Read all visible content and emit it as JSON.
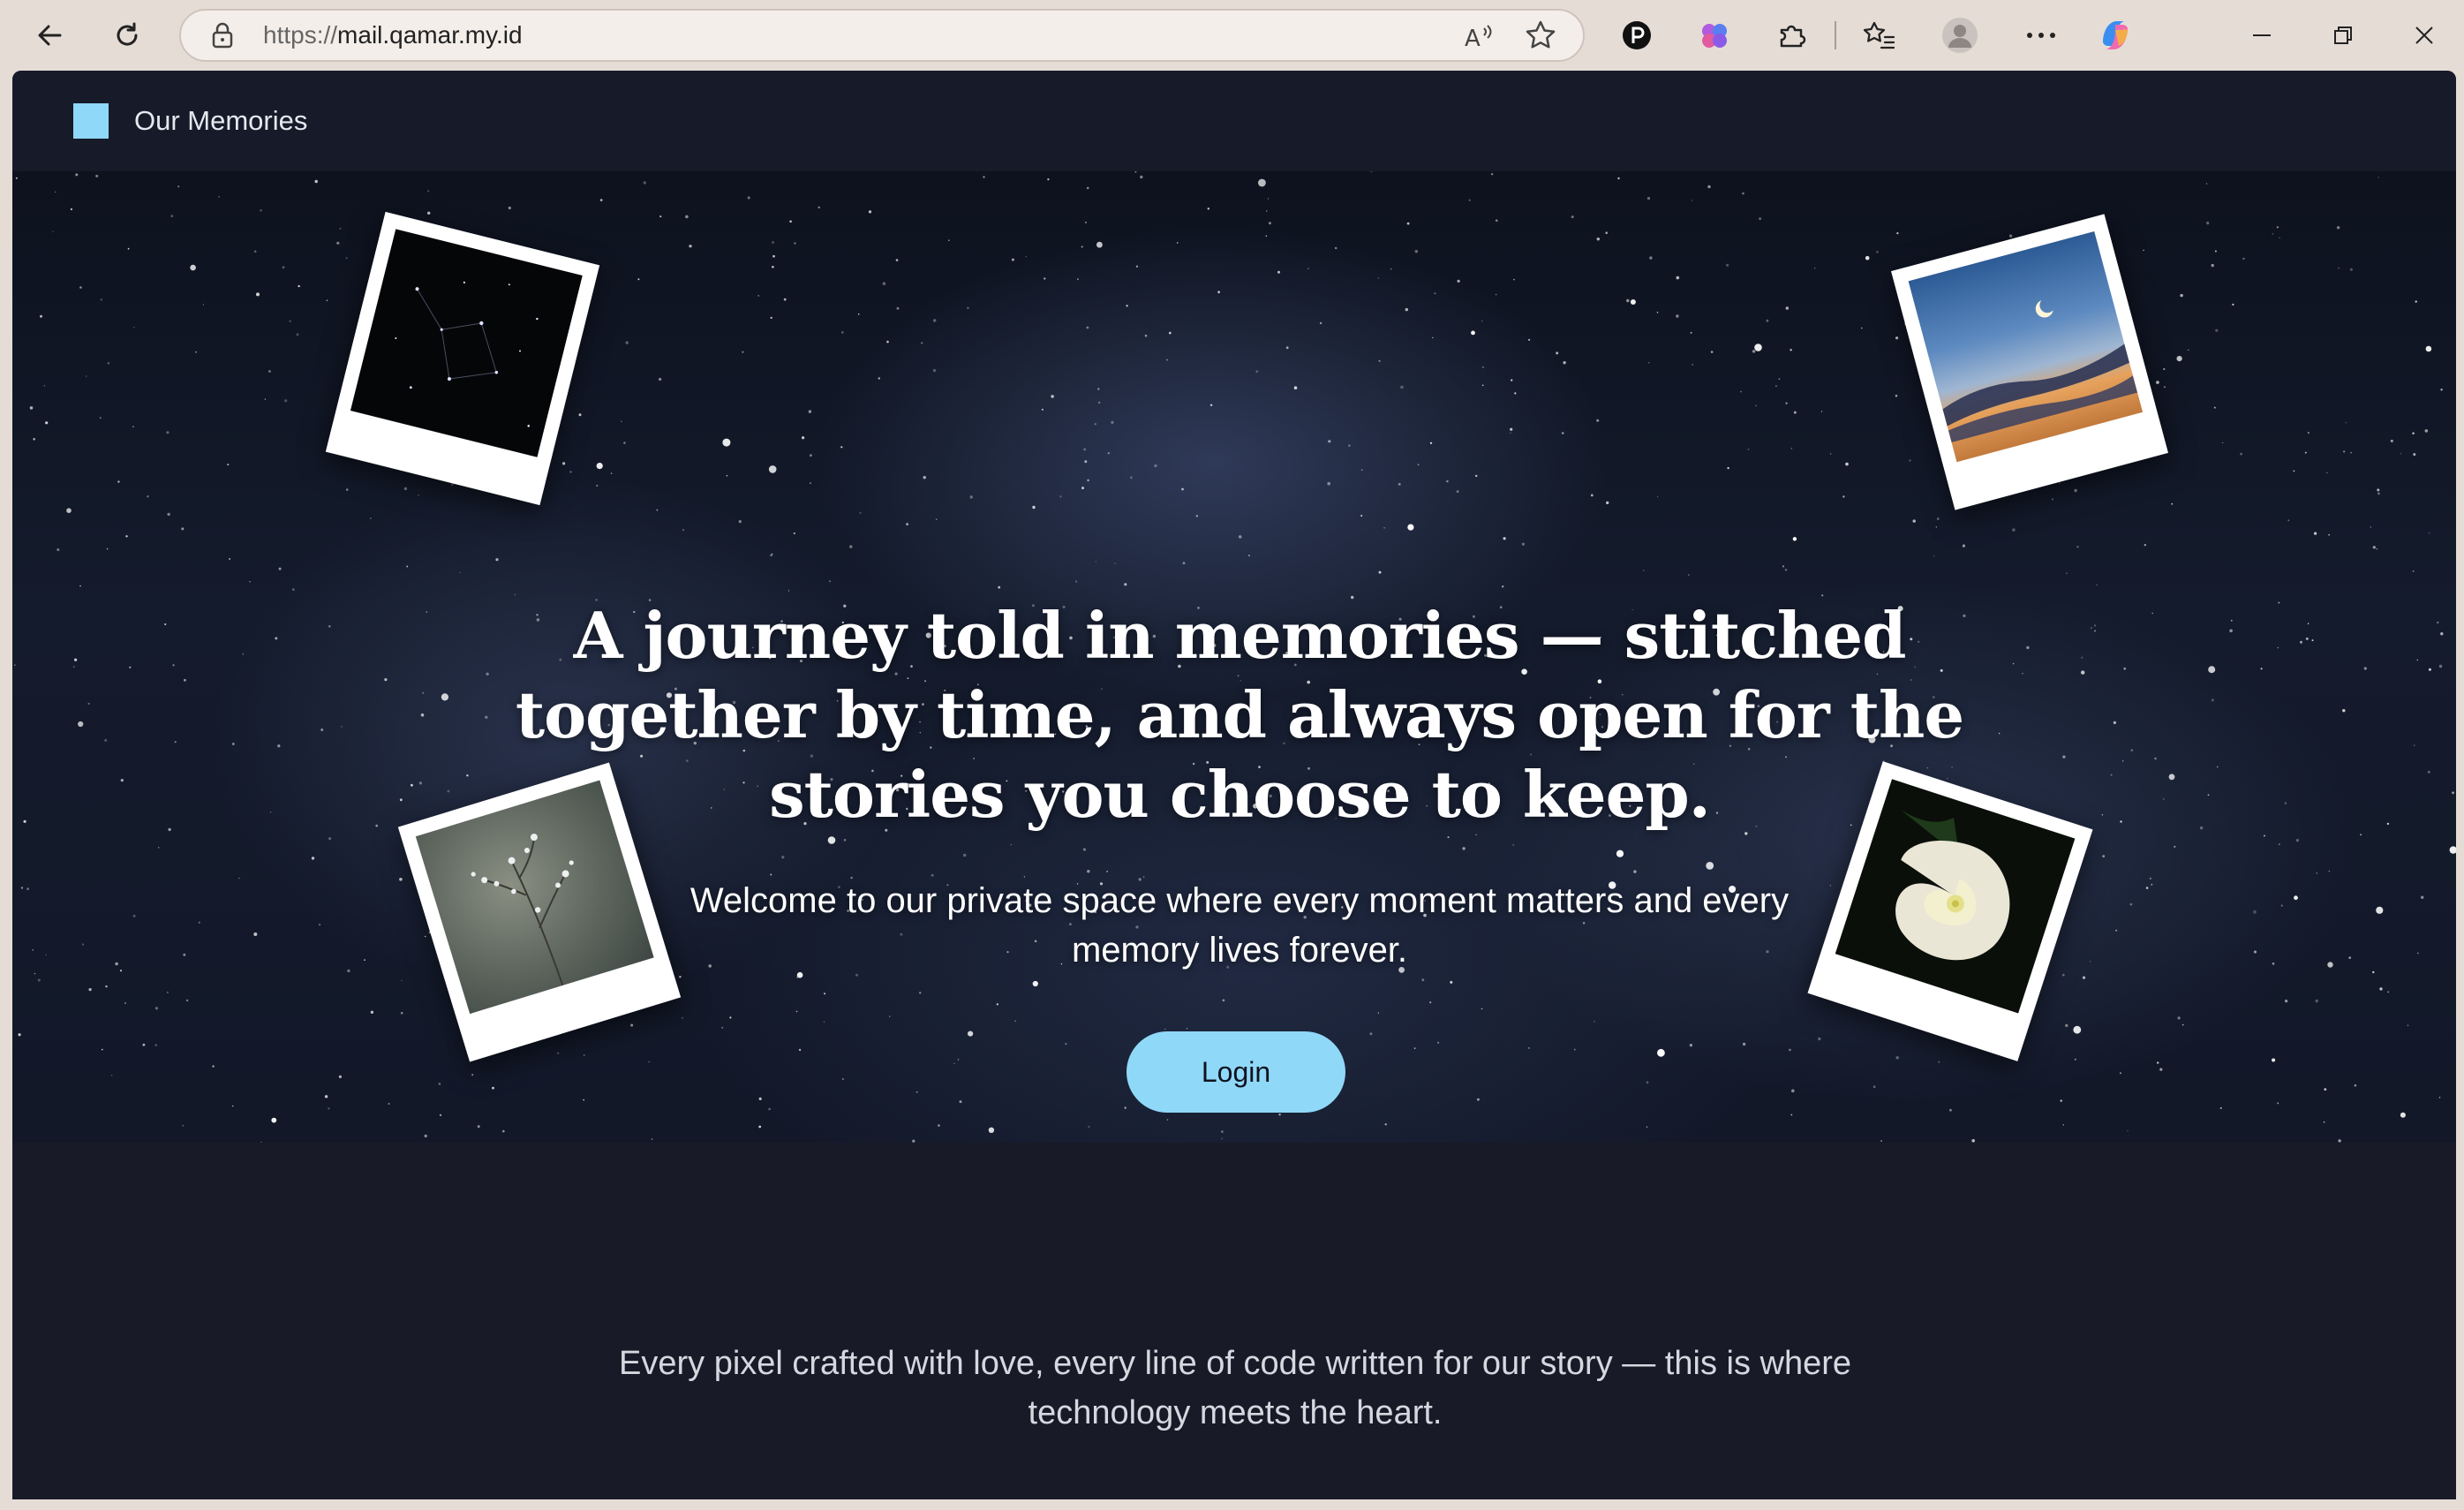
{
  "browser": {
    "url_protocol": "https://",
    "url_host": "mail.qamar.my.id"
  },
  "site": {
    "brand": "Our Memories"
  },
  "hero": {
    "headline": "A journey told in memories — stitched together by time, and always open for the stories you choose to keep.",
    "subtext": "Welcome to our private space where every moment matters and every memory lives forever.",
    "login_label": "Login"
  },
  "footer": {
    "text": "Every pixel crafted with love, every line of code written for our story — this is where technology meets the heart."
  },
  "colors": {
    "accent": "#8fd8f8",
    "page_bg": "#181a28",
    "chrome_bg": "#e6dcd6"
  }
}
